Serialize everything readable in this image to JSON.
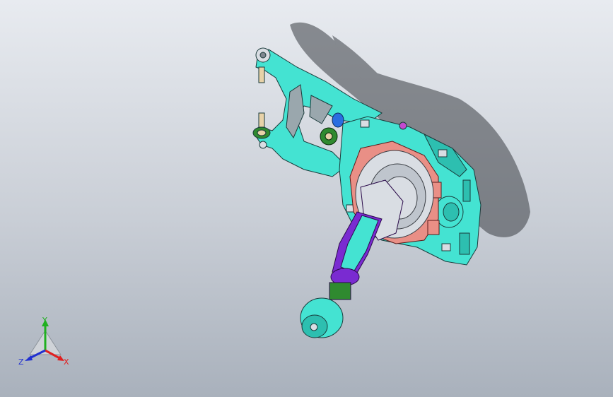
{
  "triad": {
    "x_label": "X",
    "y_label": "Y",
    "z_label": "Z",
    "x_color": "#e02020",
    "y_color": "#20b020",
    "z_color": "#2030d0"
  },
  "colors": {
    "cyan_part": "#44e3d2",
    "purple_part": "#7a2bd1",
    "salmon_part": "#e98f86",
    "green_part": "#2f8a2f",
    "blue_part": "#2a6ee0",
    "grey_part": "#d9dde3",
    "shadow": "#3a3e44"
  }
}
